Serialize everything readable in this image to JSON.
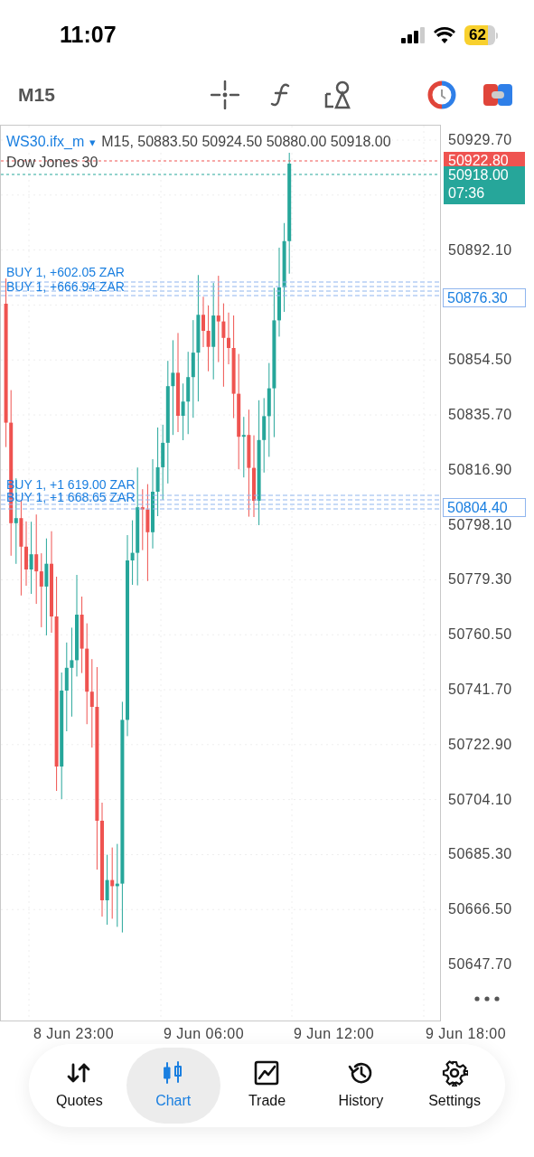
{
  "status_bar": {
    "time": "11:07",
    "battery": "62"
  },
  "toolbar": {
    "timeframe": "M15"
  },
  "chart": {
    "symbol": "WS30.ifx_m",
    "symbol_caret": "▾",
    "ohlc": "M15, 50883.50 50924.50 50880.00 50918.00",
    "description": "Dow Jones 30",
    "order_labels": [
      {
        "text": "BUY 1, +602.05 ZAR"
      },
      {
        "text": "BUY 1, +666.94 ZAR"
      },
      {
        "text": "BUY 1, +1 619.00 ZAR"
      },
      {
        "text": "BUY 1, +1 668.65 ZAR"
      }
    ],
    "price_ticks": [
      "50929.70",
      "50892.10",
      "50854.50",
      "50835.70",
      "50816.90",
      "50798.10",
      "50779.30",
      "50760.50",
      "50741.70",
      "50722.90",
      "50704.10",
      "50685.30",
      "50666.50",
      "50647.70"
    ],
    "price_boxes": [
      {
        "kind": "ask",
        "text": "50922.80"
      },
      {
        "kind": "bid",
        "text": "50918.00",
        "timer": "07:36"
      },
      {
        "kind": "order",
        "text": "50876.30"
      },
      {
        "kind": "order",
        "text": "50804.40"
      }
    ],
    "time_ticks": [
      "8 Jun 23:00",
      "9 Jun 06:00",
      "9 Jun 12:00",
      "9 Jun 18:00"
    ]
  },
  "nav": [
    {
      "label": "Quotes",
      "selected": false
    },
    {
      "label": "Chart",
      "selected": true
    },
    {
      "label": "Trade",
      "selected": false
    },
    {
      "label": "History",
      "selected": false
    },
    {
      "label": "Settings",
      "selected": false
    }
  ]
}
